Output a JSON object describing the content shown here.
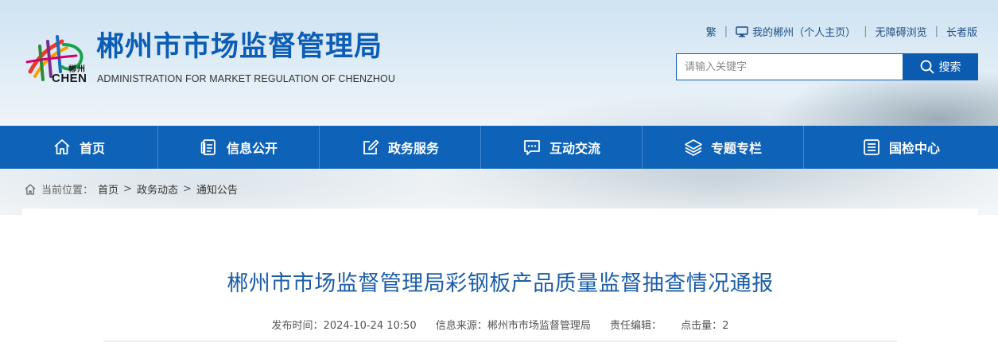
{
  "header": {
    "logo_cn_small": "郴州",
    "logo_en_small": "CHEN",
    "title": "郴州市市场监督管理局",
    "subtitle": "ADMINISTRATION FOR MARKET REGULATION OF CHENZHOU",
    "top_links": {
      "traditional": "繁",
      "my_chenzhou": "我的郴州（个人主页）",
      "accessible": "无障碍浏览",
      "elder": "长者版"
    },
    "search": {
      "placeholder": "请输入关键字",
      "button": "搜索"
    }
  },
  "nav": {
    "items": [
      {
        "label": "首页",
        "icon": "home-icon"
      },
      {
        "label": "信息公开",
        "icon": "document-icon"
      },
      {
        "label": "政务服务",
        "icon": "edit-icon"
      },
      {
        "label": "互动交流",
        "icon": "chat-icon"
      },
      {
        "label": "专题专栏",
        "icon": "layers-icon"
      },
      {
        "label": "国检中心",
        "icon": "list-icon"
      }
    ]
  },
  "breadcrumb": {
    "label": "当前位置：",
    "items": [
      "首页",
      "政务动态",
      "通知公告"
    ],
    "separator": ">"
  },
  "article": {
    "title": "郴州市市场监督管理局彩钢板产品质量监督抽查情况通报",
    "meta": {
      "publish_time_label": "发布时间：",
      "publish_time": "2024-10-24 10:50",
      "source_label": "信息来源：",
      "source": "郴州市市场监督管理局",
      "editor_label": "责任编辑：",
      "editor": "",
      "hits_label": "点击量：",
      "hits": "2"
    }
  },
  "colors": {
    "brand_blue": "#0e62b8",
    "title_blue": "#1d5ea8"
  }
}
